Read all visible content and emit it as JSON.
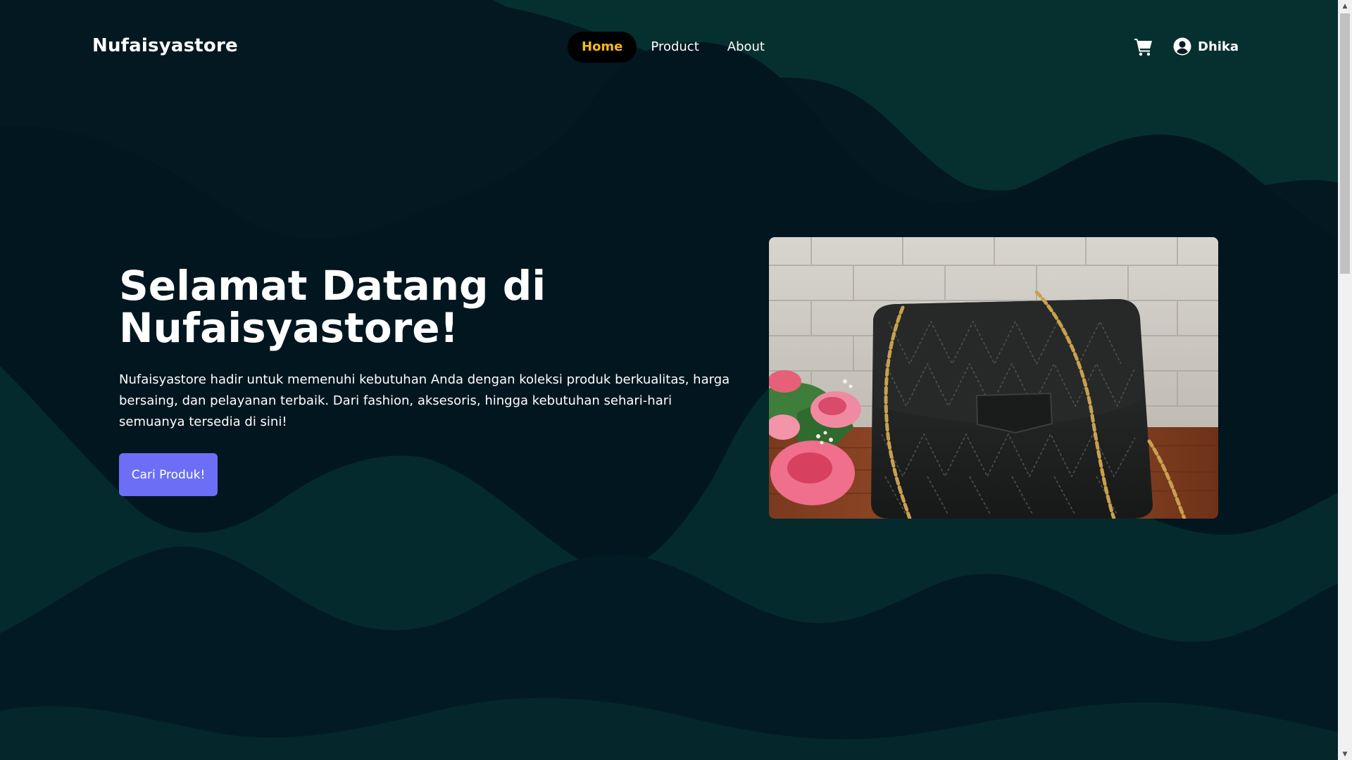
{
  "brand": "Nufaisyastore",
  "nav": {
    "items": [
      {
        "label": "Home",
        "active": true
      },
      {
        "label": "Product",
        "active": false
      },
      {
        "label": "About",
        "active": false
      }
    ]
  },
  "header_right": {
    "cart_icon": "cart-icon",
    "user_icon": "user-circle-icon",
    "user_name": "Dhika"
  },
  "hero": {
    "title_line1": "Selamat Datang di",
    "title_line2": "Nufaisyastore!",
    "description": "Nufaisyastore hadir untuk memenuhi kebutuhan Anda dengan koleksi produk berkualitas, harga bersaing, dan pelayanan terbaik. Dari fashion, aksesoris, hingga kebutuhan sehari-hari semuanya tersedia di sini!",
    "cta_label": "Cari Produk!"
  },
  "colors": {
    "background_dark": "#02111a",
    "wave_teal": "#06302f",
    "active_nav_text": "#f7b91a",
    "active_nav_bg": "#000000",
    "cta_bg": "#6c6ff5"
  }
}
